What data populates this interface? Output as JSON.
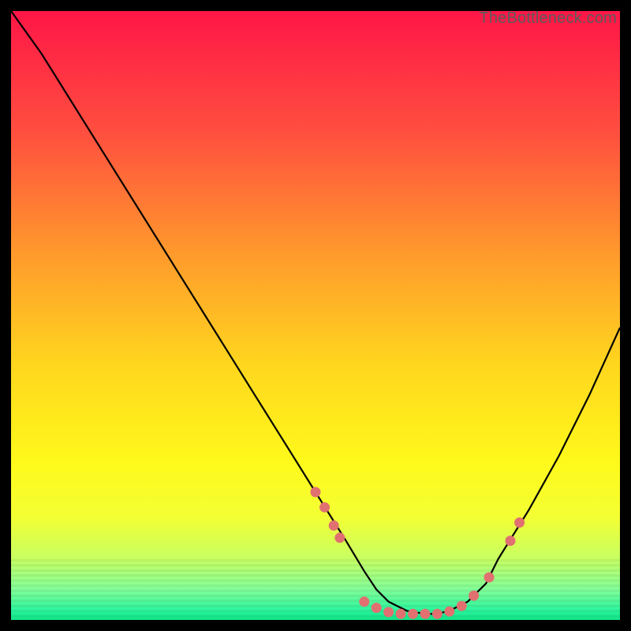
{
  "watermark": "TheBottleneck.com",
  "chart_data": {
    "type": "line",
    "title": "",
    "xlabel": "",
    "ylabel": "",
    "xlim": [
      0,
      100
    ],
    "ylim": [
      0,
      100
    ],
    "grid": false,
    "series": [
      {
        "name": "bottleneck-curve",
        "x": [
          0,
          5,
          10,
          15,
          20,
          25,
          30,
          35,
          40,
          45,
          50,
          55,
          58,
          60,
          62,
          65,
          68,
          70,
          72,
          75,
          78,
          80,
          85,
          90,
          95,
          100
        ],
        "values": [
          100,
          93,
          85,
          77,
          69,
          61,
          53,
          45,
          37,
          29,
          21,
          13,
          8,
          5,
          3,
          1.5,
          1,
          1,
          1.5,
          3,
          6,
          10,
          18,
          27,
          37,
          48
        ]
      }
    ],
    "markers": {
      "name": "highlight-dots",
      "color": "#e17070",
      "points": [
        {
          "x": 50,
          "y": 21
        },
        {
          "x": 51.5,
          "y": 18.5
        },
        {
          "x": 53,
          "y": 15.5
        },
        {
          "x": 54,
          "y": 13.5
        },
        {
          "x": 58,
          "y": 3
        },
        {
          "x": 60,
          "y": 2
        },
        {
          "x": 62,
          "y": 1.3
        },
        {
          "x": 64,
          "y": 1
        },
        {
          "x": 66,
          "y": 1
        },
        {
          "x": 68,
          "y": 1
        },
        {
          "x": 70,
          "y": 1
        },
        {
          "x": 72,
          "y": 1.4
        },
        {
          "x": 74,
          "y": 2.3
        },
        {
          "x": 76,
          "y": 4
        },
        {
          "x": 78.5,
          "y": 7
        },
        {
          "x": 82,
          "y": 13
        },
        {
          "x": 83.5,
          "y": 16
        }
      ]
    },
    "background": {
      "type": "vertical-gradient",
      "stops": [
        {
          "pos": 0.0,
          "color": "#ff1647"
        },
        {
          "pos": 0.2,
          "color": "#ff4f3f"
        },
        {
          "pos": 0.4,
          "color": "#ff9a2c"
        },
        {
          "pos": 0.58,
          "color": "#ffd61e"
        },
        {
          "pos": 0.74,
          "color": "#fff91b"
        },
        {
          "pos": 0.83,
          "color": "#f3ff33"
        },
        {
          "pos": 0.9,
          "color": "#c7ff63"
        },
        {
          "pos": 0.95,
          "color": "#83ff99"
        },
        {
          "pos": 0.985,
          "color": "#29f59c"
        },
        {
          "pos": 1.0,
          "color": "#12e488"
        }
      ]
    }
  }
}
